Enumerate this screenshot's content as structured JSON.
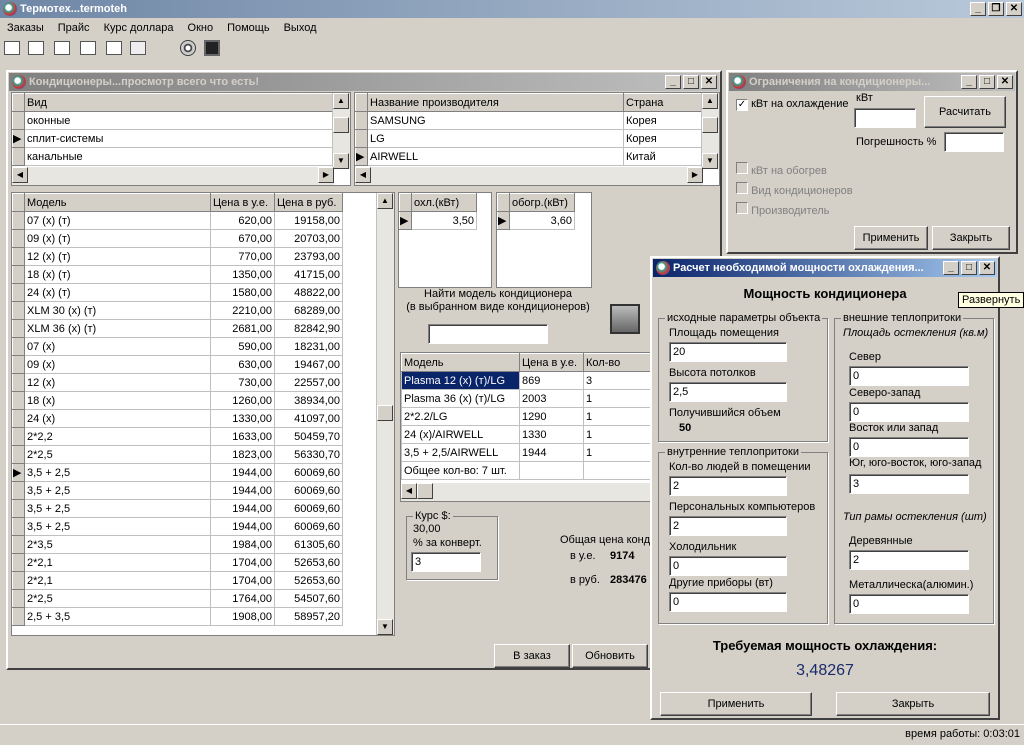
{
  "app": {
    "title": "Термотех...termoteh"
  },
  "menu": [
    "Заказы",
    "Прайс",
    "Курс доллара",
    "Окно",
    "Помощь",
    "Выход"
  ],
  "toolbar_icons": [
    "open-icon",
    "preview-icon",
    "print-preview-icon",
    "print-icon",
    "copy-icon",
    "folder-icon",
    "fan-icon",
    "cooler-icon"
  ],
  "main_win": {
    "title": "Кондиционеры...просмотр всего что есть!",
    "vid_header": "Вид",
    "vid_items": [
      "оконные",
      "сплит-системы",
      "канальные"
    ],
    "vid_selected": 1,
    "maker_headers": [
      "Название производителя",
      "Страна"
    ],
    "makers": [
      [
        "SAMSUNG",
        "Корея"
      ],
      [
        "LG",
        "Корея"
      ],
      [
        "AIRWELL",
        "Китай"
      ]
    ],
    "maker_selected": 2,
    "models_headers": [
      "Модель",
      "Цена в у.е.",
      "Цена в руб."
    ],
    "models": [
      [
        "07 (x) (т)",
        "620,00",
        "19158,00"
      ],
      [
        "09 (x) (т)",
        "670,00",
        "20703,00"
      ],
      [
        "12 (x) (т)",
        "770,00",
        "23793,00"
      ],
      [
        "18 (x) (т)",
        "1350,00",
        "41715,00"
      ],
      [
        "24 (x) (т)",
        "1580,00",
        "48822,00"
      ],
      [
        "XLM 30 (x) (т)",
        "2210,00",
        "68289,00"
      ],
      [
        "XLM 36 (x) (т)",
        "2681,00",
        "82842,90"
      ],
      [
        "07 (x)",
        "590,00",
        "18231,00"
      ],
      [
        "09 (x)",
        "630,00",
        "19467,00"
      ],
      [
        "12 (x)",
        "730,00",
        "22557,00"
      ],
      [
        "18 (x)",
        "1260,00",
        "38934,00"
      ],
      [
        "24 (x)",
        "1330,00",
        "41097,00"
      ],
      [
        "2*2,2",
        "1633,00",
        "50459,70"
      ],
      [
        "2*2,5",
        "1823,00",
        "56330,70"
      ],
      [
        "3,5 + 2,5",
        "1944,00",
        "60069,60"
      ],
      [
        "3,5 + 2,5",
        "1944,00",
        "60069,60"
      ],
      [
        "3,5 + 2,5",
        "1944,00",
        "60069,60"
      ],
      [
        "3,5 + 2,5",
        "1944,00",
        "60069,60"
      ],
      [
        "2*3,5",
        "1984,00",
        "61305,60"
      ],
      [
        "2*2,1",
        "1704,00",
        "52653,60"
      ],
      [
        "2*2,1",
        "1704,00",
        "52653,60"
      ],
      [
        "2*2,5",
        "1764,00",
        "54507,60"
      ],
      [
        "2,5 + 3,5",
        "1908,00",
        "58957,20"
      ]
    ],
    "models_selected": 14,
    "ohl_header": "охл.(кВт)",
    "ohl_value": "3,50",
    "obogr_header": "обогр.(кВт)",
    "obogr_value": "3,60",
    "find_label": "Найти модель кондиционера",
    "find_sub": "(в выбранном виде кондиционеров)",
    "find_value": "",
    "order_headers": [
      "Модель",
      "Цена в у.е.",
      "Кол-во"
    ],
    "orders": [
      [
        "Plasma 12 (x) (т)/LG",
        "869",
        "3"
      ],
      [
        "Plasma 36 (x) (т)/LG",
        "2003",
        "1"
      ],
      [
        "2*2.2/LG",
        "1290",
        "1"
      ],
      [
        "24 (x)/AIRWELL",
        "1330",
        "1"
      ],
      [
        "3,5 + 2,5/AIRWELL",
        "1944",
        "1"
      ]
    ],
    "order_total": "Общее кол-во: 7 шт.",
    "kurs_label": "Курс $:",
    "kurs_value": "30,00",
    "konv_label": "% за конверт.",
    "konv_value": "3",
    "total_label": "Общая цена конд",
    "total_ue_label": "в  у.е.",
    "total_ue": "9174",
    "total_rub_label": "в  руб.",
    "total_rub": "283476",
    "btn_order": "В заказ",
    "btn_refresh": "Обновить"
  },
  "limits_win": {
    "title": "Ограничения на кондиционеры...",
    "chk_cool": "кВт на охлаждение",
    "kw_label": "кВт",
    "kw_value": "",
    "btn_calc": "Расчитать",
    "err_label": "Погрешность %",
    "err_value": "",
    "chk_heat": "кВт на обогрев",
    "chk_kind": "Вид кондиционеров",
    "chk_maker": "Производитель",
    "btn_apply": "Применить",
    "btn_close": "Закрыть"
  },
  "calc_win": {
    "title": "Расчет необходимой мощности охлаждения...",
    "heading": "Мощность кондиционера",
    "grp_src": "исходные параметры объекта",
    "area_label": "Площадь помещения",
    "area": "20",
    "height_label": "Высота потолков",
    "height": "2,5",
    "vol_label": "Получившийся объем",
    "vol": "50",
    "grp_inner": "внутренние теплопритоки",
    "people_label": "Кол-во людей в помещении",
    "people": "2",
    "pc_label": "Персональных компьютеров",
    "pc": "2",
    "fridge_label": "Холодильник",
    "fridge": "0",
    "other_label": "Другие приборы (вт)",
    "other": "0",
    "grp_outer": "внешние теплопритоки",
    "glass_area": "Площадь остекления (кв.м)",
    "north_label": "Север",
    "north": "0",
    "nw_label": "Северо-запад",
    "nw": "0",
    "ew_label": "Восток или запад",
    "ew": "0",
    "south_label": "Юг, юго-восток, юго-запад",
    "south": "3",
    "frame_type": "Тип рамы остекления (шт)",
    "wood_label": "Деревянные",
    "wood": "2",
    "metal_label": "Металлическа(алюмин.)",
    "metal": "0",
    "req_label": "Требуемая мощность охлаждения:",
    "req_value": "3,48267",
    "btn_apply": "Применить",
    "btn_close": "Закрыть"
  },
  "tooltip": "Развернуть",
  "status": {
    "work_time": "время работы:  0:03:01"
  }
}
